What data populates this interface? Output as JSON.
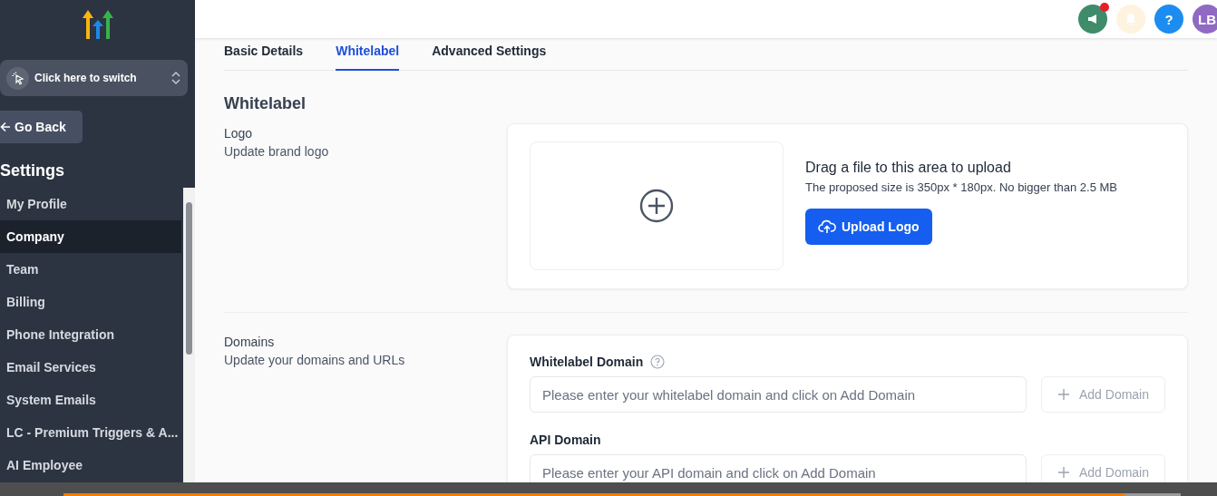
{
  "sidebar": {
    "switcher": {
      "label": "Click here to switch"
    },
    "back_button": "Go Back",
    "title": "Settings",
    "items": [
      {
        "label": "My Profile",
        "selected": false
      },
      {
        "label": "Company",
        "selected": true
      },
      {
        "label": "Team",
        "selected": false
      },
      {
        "label": "Billing",
        "selected": false
      },
      {
        "label": "Phone Integration",
        "selected": false
      },
      {
        "label": "Email Services",
        "selected": false
      },
      {
        "label": "System Emails",
        "selected": false
      },
      {
        "label": "LC - Premium Triggers & A...",
        "selected": false
      },
      {
        "label": "AI Employee",
        "selected": false
      }
    ]
  },
  "header": {
    "notification_dot": true,
    "help": "?",
    "avatar": "LB"
  },
  "tabs": [
    {
      "label": "Basic Details",
      "selected": false
    },
    {
      "label": "Whitelabel",
      "selected": true
    },
    {
      "label": "Advanced Settings",
      "selected": false
    }
  ],
  "section_title": "Whitelabel",
  "logo": {
    "title": "Logo",
    "subtitle": "Update brand logo",
    "drop_title": "Drag a file to this area to upload",
    "drop_hint": "The proposed size is 350px * 180px. No bigger than 2.5 MB",
    "button": "Upload Logo"
  },
  "domains": {
    "title": "Domains",
    "subtitle": "Update your domains and URLs",
    "fields": [
      {
        "label": "Whitelabel Domain",
        "help": true,
        "placeholder": "Please enter your whitelabel domain and click on Add Domain",
        "button": "Add Domain"
      },
      {
        "label": "API Domain",
        "help": false,
        "placeholder": "Please enter your API domain and click on Add Domain",
        "button": "Add Domain"
      }
    ]
  },
  "video_player": {
    "level": 0.95
  }
}
